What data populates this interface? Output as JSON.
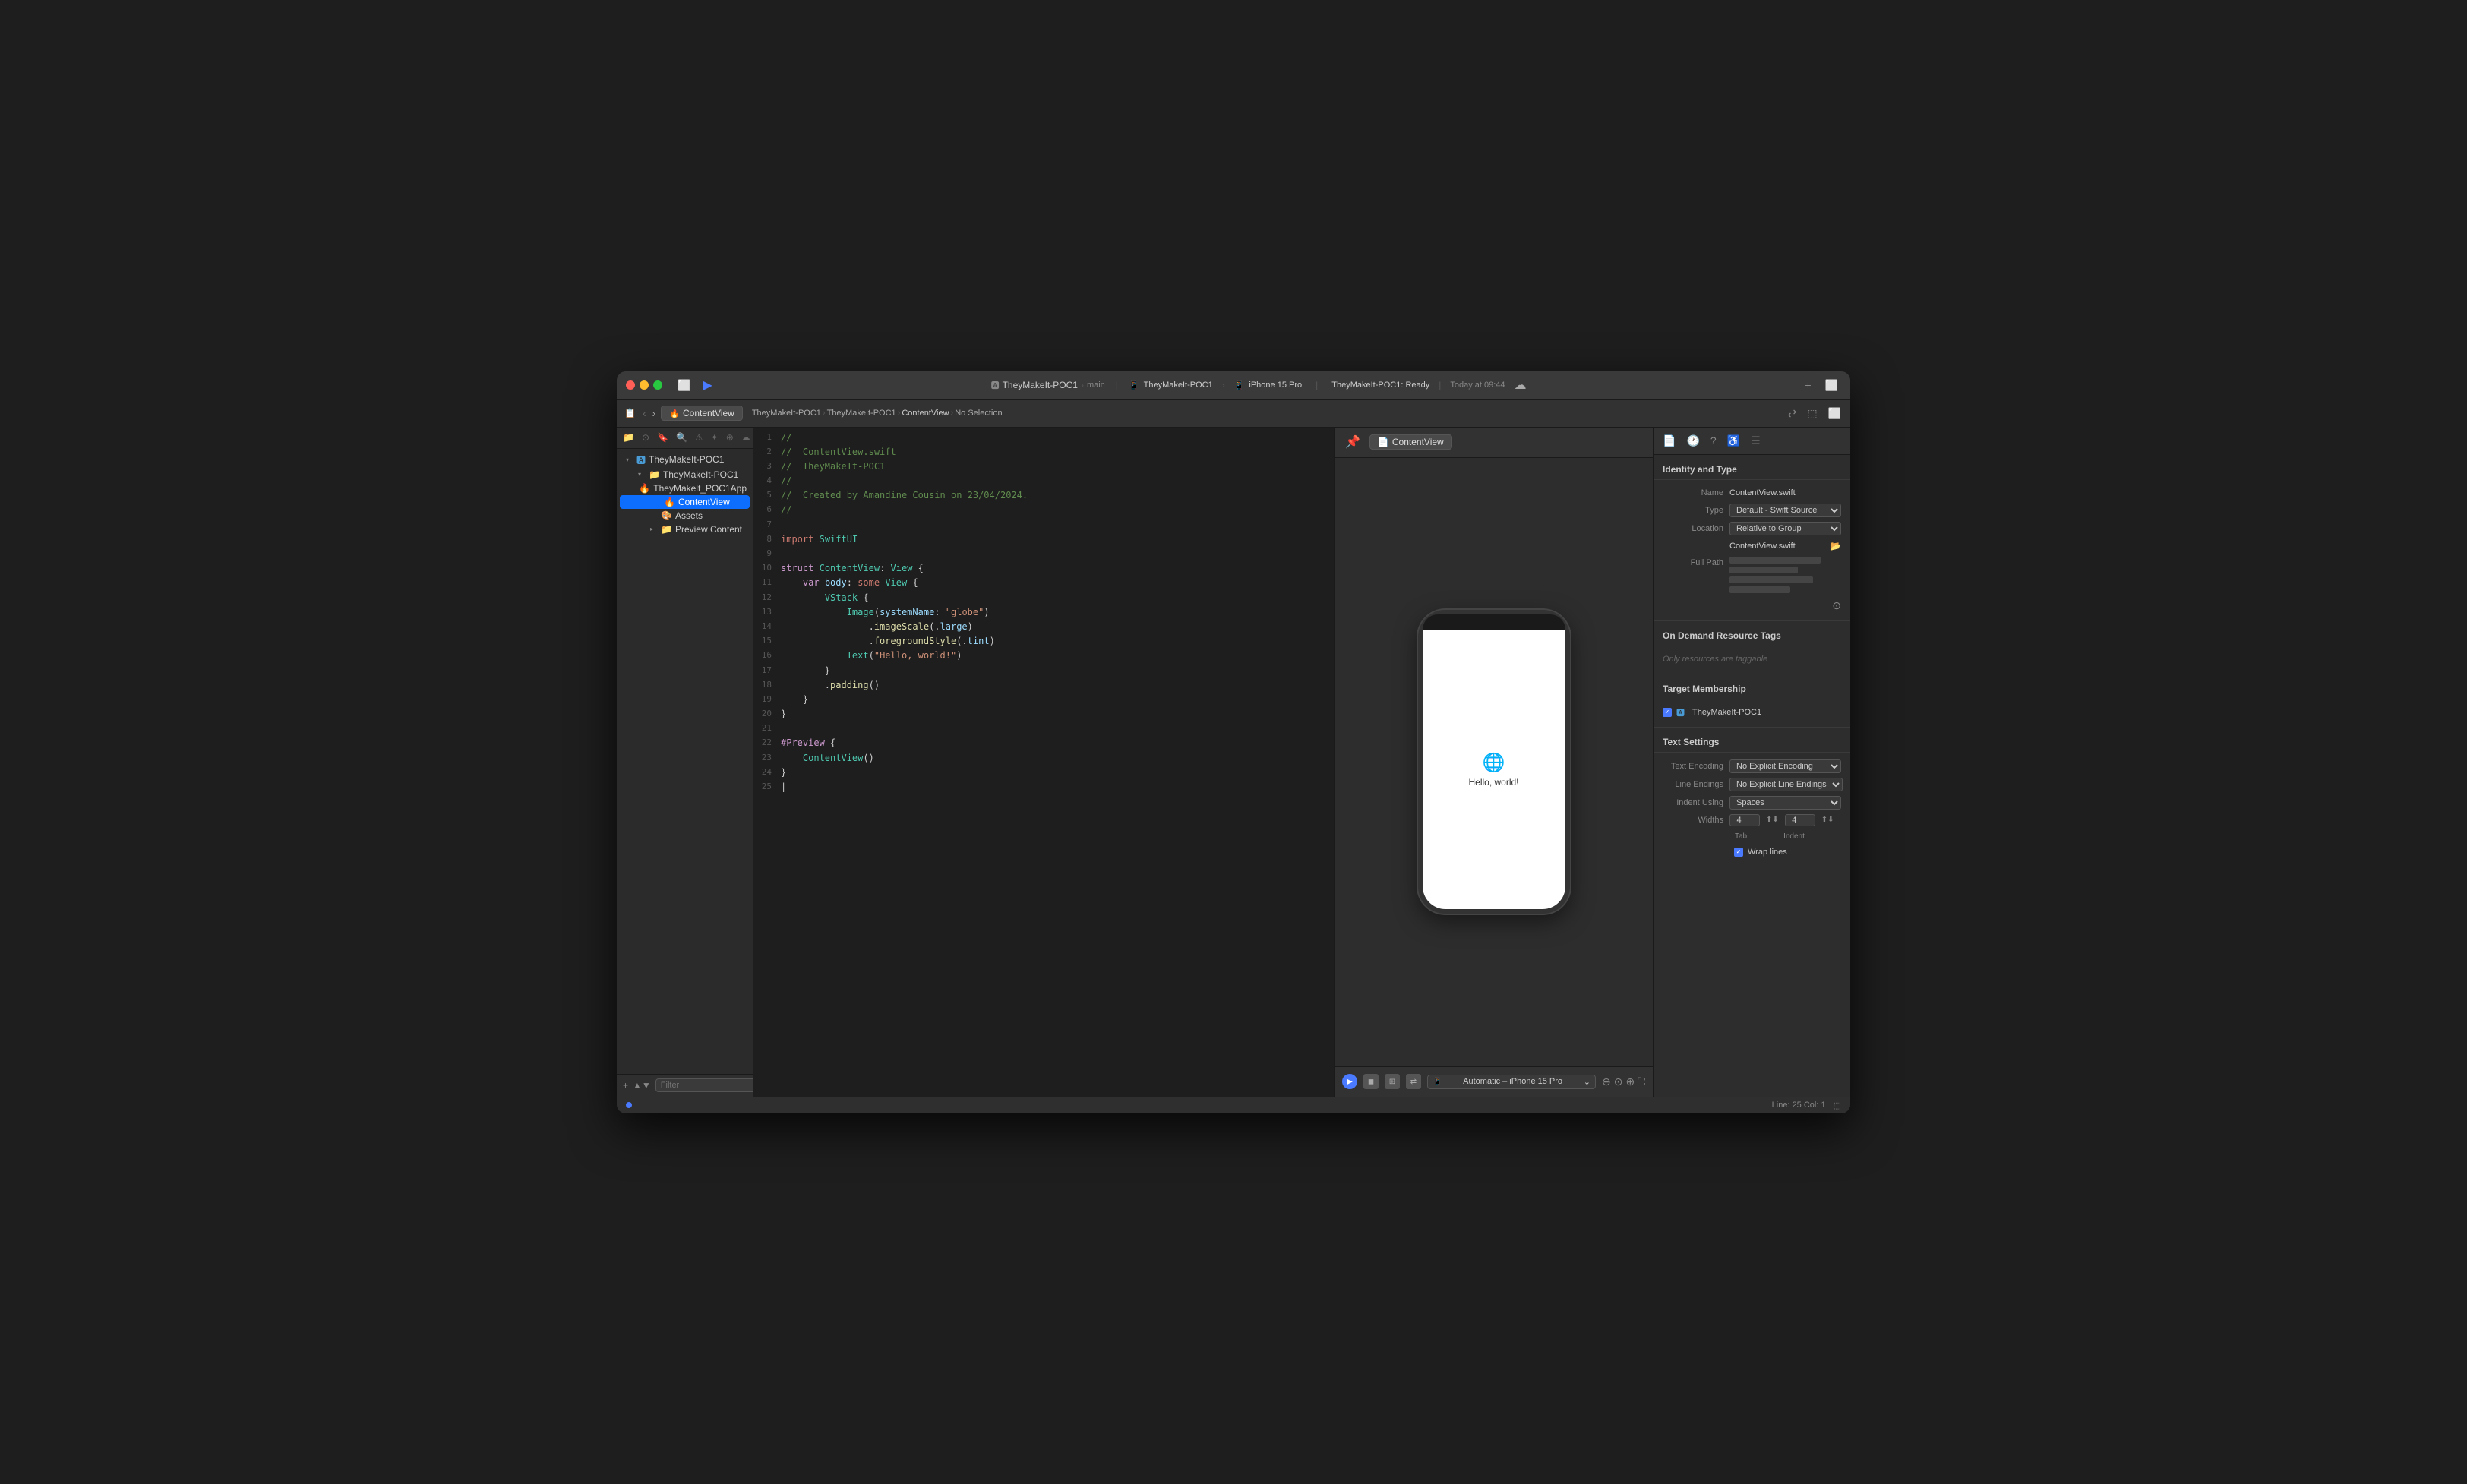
{
  "window": {
    "title": "TheyMakeIt-POC1",
    "subtitle": "main"
  },
  "titlebar": {
    "project_name": "TheyMakeIt-POC1",
    "branch": "main",
    "scheme": "TheyMakeIt-POC1",
    "device": "iPhone 15 Pro",
    "status": "TheyMakeIt-POC1: Ready",
    "time": "Today at 09:44",
    "play_label": "▶",
    "stop_label": "◼",
    "nav_back": "‹",
    "nav_forward": "›",
    "plus_label": "+",
    "sidebar_toggle": "⬜"
  },
  "toolbar": {
    "tab_label": "ContentView",
    "tab_icon": "🔥",
    "breadcrumb": {
      "items": [
        "TheyMakeIt-POC1",
        "TheyMakeIt-POC1",
        "ContentView",
        "No Selection"
      ]
    }
  },
  "sidebar": {
    "items": [
      {
        "label": "TheyMakeIt-POC1",
        "level": 0,
        "type": "project",
        "icon": "🅰",
        "expanded": true
      },
      {
        "label": "TheyMakeIt-POC1",
        "level": 1,
        "type": "folder",
        "icon": "📁",
        "expanded": true
      },
      {
        "label": "TheyMakelt_POC1App",
        "level": 2,
        "type": "swift",
        "icon": "🔥"
      },
      {
        "label": "ContentView",
        "level": 2,
        "type": "swift",
        "icon": "🔥",
        "selected": true
      },
      {
        "label": "Assets",
        "level": 2,
        "type": "assets",
        "icon": "🎨"
      },
      {
        "label": "Preview Content",
        "level": 2,
        "type": "folder",
        "icon": "📁"
      }
    ],
    "filter_placeholder": "Filter"
  },
  "code": {
    "lines": [
      {
        "num": 1,
        "content": "//"
      },
      {
        "num": 2,
        "content": "//  ContentView.swift"
      },
      {
        "num": 3,
        "content": "//  TheyMakeIt-POC1"
      },
      {
        "num": 4,
        "content": "//"
      },
      {
        "num": 5,
        "content": "//  Created by Amandine Cousin on 23/04/2024."
      },
      {
        "num": 6,
        "content": "//"
      },
      {
        "num": 7,
        "content": ""
      },
      {
        "num": 8,
        "content": "import SwiftUI"
      },
      {
        "num": 9,
        "content": ""
      },
      {
        "num": 10,
        "content": "struct ContentView: View {"
      },
      {
        "num": 11,
        "content": "    var body: some View {"
      },
      {
        "num": 12,
        "content": "        VStack {"
      },
      {
        "num": 13,
        "content": "            Image(systemName: \"globe\")"
      },
      {
        "num": 14,
        "content": "                .imageScale(.large)"
      },
      {
        "num": 15,
        "content": "                .foregroundStyle(.tint)"
      },
      {
        "num": 16,
        "content": "            Text(\"Hello, world!\")"
      },
      {
        "num": 17,
        "content": "        }"
      },
      {
        "num": 18,
        "content": "        .padding()"
      },
      {
        "num": 19,
        "content": "    }"
      },
      {
        "num": 20,
        "content": "}"
      },
      {
        "num": 21,
        "content": ""
      },
      {
        "num": 22,
        "content": "#Preview {"
      },
      {
        "num": 23,
        "content": "    ContentView()"
      },
      {
        "num": 24,
        "content": "}"
      },
      {
        "num": 25,
        "content": ""
      }
    ]
  },
  "preview": {
    "tab_label": "ContentView",
    "tab_icon": "📄",
    "phone_content": {
      "globe_emoji": "🌐",
      "hello_text": "Hello, world!"
    },
    "device_selector": "Automatic – iPhone 15 Pro",
    "controls": {
      "play": "▶",
      "stop": "◼",
      "grid": "⊞",
      "swap": "⇄"
    }
  },
  "inspector": {
    "title": "Identity and Type",
    "name_label": "Name",
    "name_value": "ContentView.swift",
    "type_label": "Type",
    "type_value": "Default - Swift Source",
    "location_label": "Location",
    "location_value": "Relative to Group",
    "location_file": "ContentView.swift",
    "fullpath_label": "Full Path",
    "on_demand_title": "On Demand Resource Tags",
    "on_demand_placeholder": "Only resources are taggable",
    "target_title": "Target Membership",
    "target_item": "TheyMakeIt-POC1",
    "text_settings_title": "Text Settings",
    "text_encoding_label": "Text Encoding",
    "text_encoding_value": "No Explicit Encoding",
    "line_endings_label": "Line Endings",
    "line_endings_value": "No Explicit Line Endings",
    "indent_using_label": "Indent Using",
    "indent_using_value": "Spaces",
    "widths_label": "Widths",
    "tab_width": "4",
    "indent_width": "4",
    "tab_label": "Tab",
    "indent_label": "Indent",
    "wrap_lines_label": "Wrap lines",
    "icons": {
      "file": "📄",
      "clock": "🕐",
      "info": "ℹ",
      "link": "🔗",
      "menu": "☰"
    }
  },
  "statusbar": {
    "position": "Line: 25  Col: 1"
  }
}
